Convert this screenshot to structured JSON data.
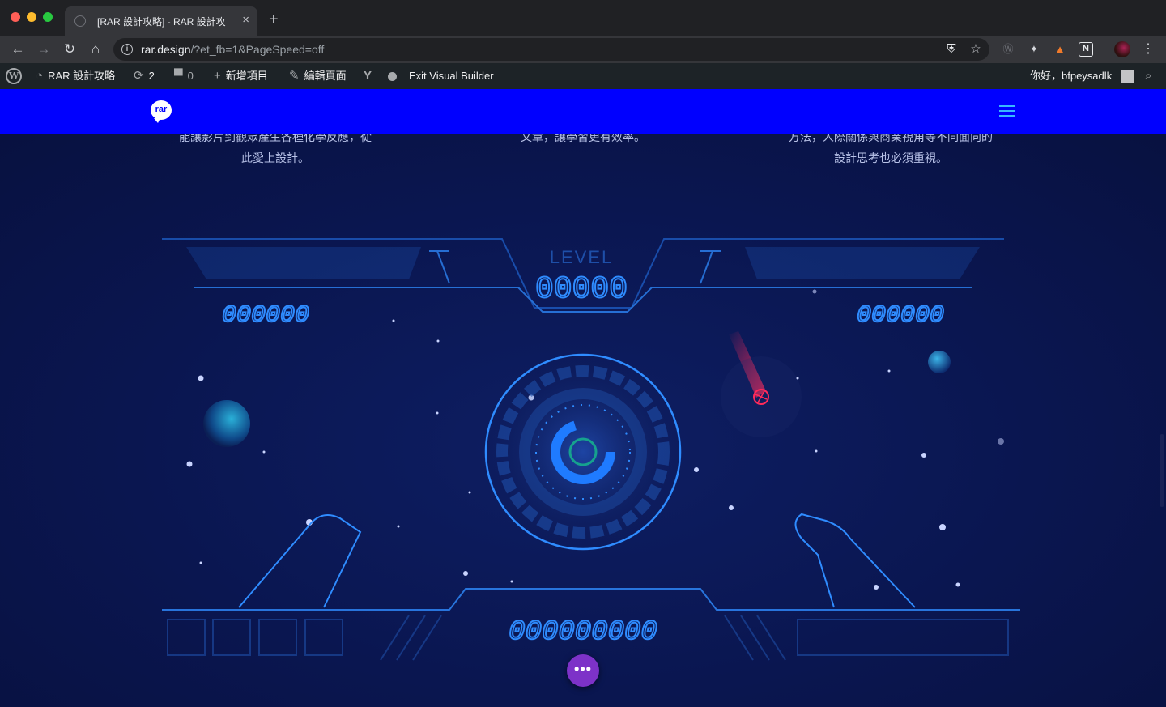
{
  "browser": {
    "tab_title": "[RAR 設計攻略] - RAR 設計攻",
    "tab_close": "×",
    "new_tab": "+",
    "url_host": "rar.design",
    "url_path": "/?et_fb=1&PageSpeed=off"
  },
  "adminbar": {
    "site_name": "RAR 設計攻略",
    "updates_count": "2",
    "comments_count": "0",
    "new_item": "新增項目",
    "edit_page": "編輯頁面",
    "exit_builder": "Exit Visual Builder",
    "greeting": "你好，bfpeysadlk"
  },
  "site": {
    "logo_text": "rar",
    "features": [
      {
        "line1": "能讓影片到觀眾產生各種化學反應，從",
        "line2": "此愛上設計。"
      },
      {
        "line1": "文章，讓學習更有效率。",
        "line2": ""
      },
      {
        "line1": "方法，人際關係與商業視角等不同面向的",
        "line2": "設計思考也必須重視。"
      }
    ],
    "hud_label": "LEVEL",
    "hud_level_digits": "00000",
    "hud_side_digits": "000000",
    "hud_bottom_digits": "000000000",
    "fab_label": "•••"
  },
  "colors": {
    "header_blue": "#0000ff",
    "page_navy": "#0b1647",
    "hud_cyan": "#2f8cff",
    "fab_purple": "#7d32c8"
  }
}
